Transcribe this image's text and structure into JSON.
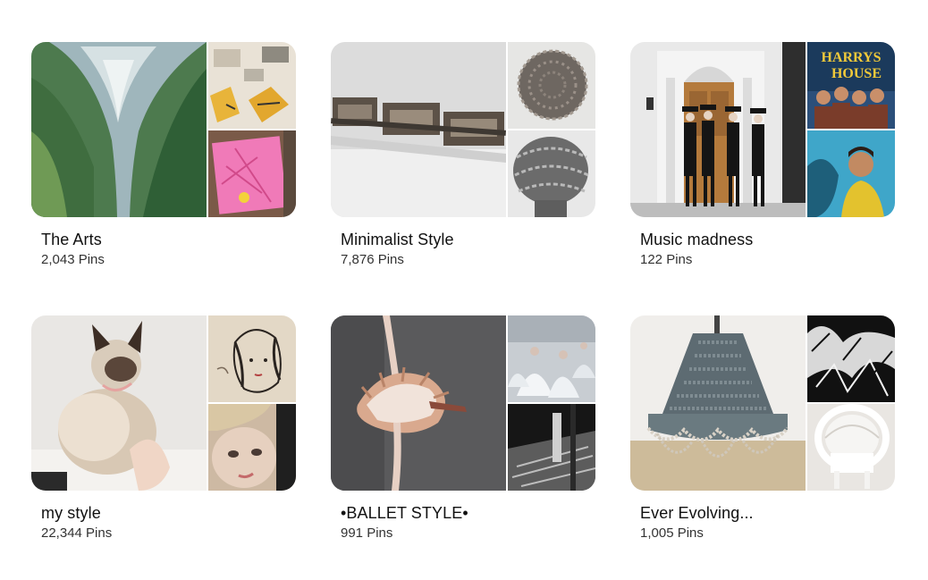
{
  "boards": [
    {
      "title": "The Arts",
      "count": "2,043 Pins"
    },
    {
      "title": "Minimalist Style",
      "count": "7,876 Pins"
    },
    {
      "title": "Music madness",
      "count": "122 Pins"
    },
    {
      "title": "my style",
      "count": "22,344 Pins"
    },
    {
      "title": "•BALLET STYLE•",
      "count": "991 Pins"
    },
    {
      "title": "Ever Evolving...",
      "count": "1,005 Pins"
    }
  ],
  "album_art_text": "HARRYS HOUSE"
}
